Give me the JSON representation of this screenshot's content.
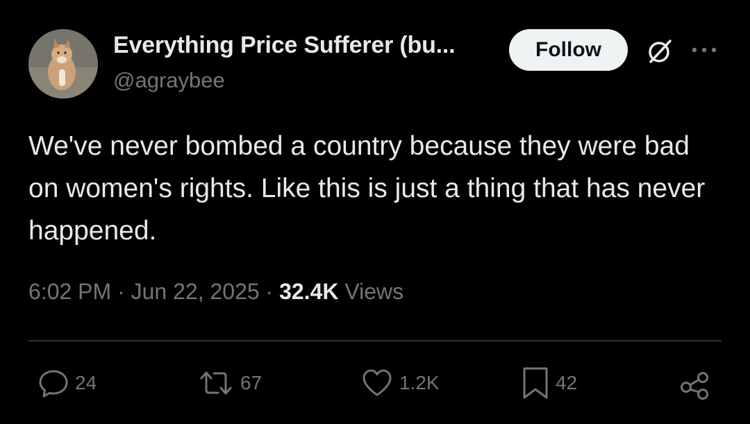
{
  "author": {
    "display_name": "Everything Price Sufferer (bu...",
    "handle": "@agraybee",
    "avatar_icon": "dog-photo-avatar"
  },
  "follow_label": "Follow",
  "tweet": {
    "text": "We've never bombed a country because they were bad on women's rights. Like this is just a thing that has never happened."
  },
  "meta": {
    "time": "6:02 PM",
    "separator": "·",
    "date": "Jun 22, 2025",
    "views_count": "32.4K",
    "views_label": "Views"
  },
  "actions": {
    "replies": "24",
    "reposts": "67",
    "likes": "1.2K",
    "bookmarks": "42"
  },
  "icons": {
    "grok": "grok-icon",
    "more": "more-icon",
    "reply": "reply-icon",
    "repost": "repost-icon",
    "like": "heart-icon",
    "bookmark": "bookmark-icon",
    "share": "share-icon"
  },
  "colors": {
    "background": "#000000",
    "primary_text": "#e7e9ea",
    "secondary_text": "#71767b",
    "divider": "#2f3336",
    "follow_bg": "#eff3f4"
  }
}
